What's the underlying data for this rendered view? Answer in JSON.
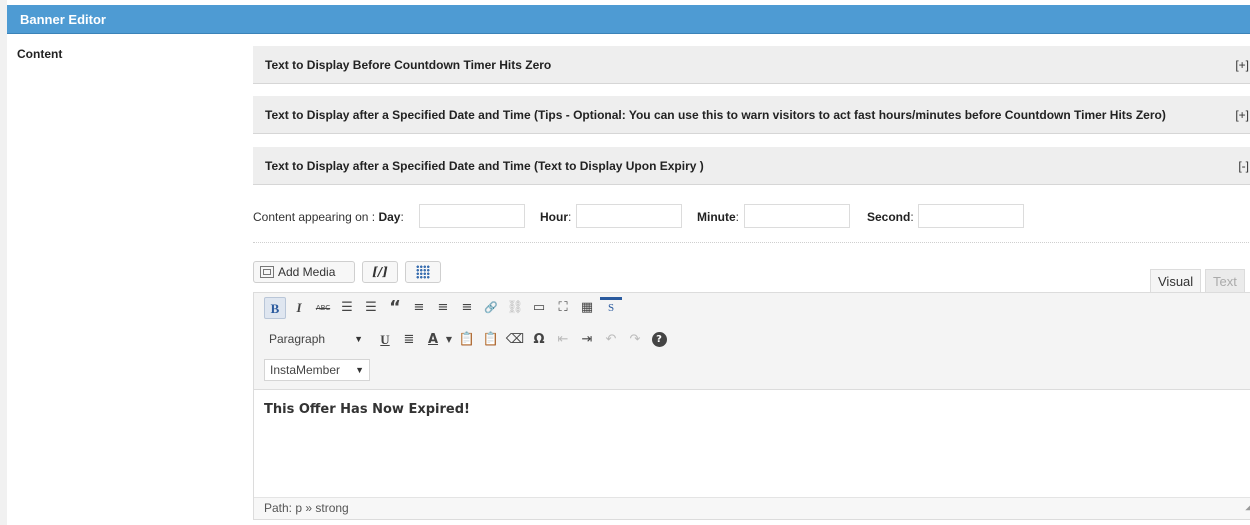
{
  "window": {
    "title": "Banner Editor"
  },
  "content_label": "Content",
  "accordions": [
    {
      "title": "Text to Display Before Countdown Timer Hits Zero",
      "toggle": "[+]"
    },
    {
      "title": "Text to Display after a Specified Date and Time (Tips - Optional: You can use this to warn visitors to act fast hours/minutes before Countdown Timer Hits Zero)",
      "toggle": "[+]"
    },
    {
      "title": "Text to Display after a Specified Date and Time (Text to Display Upon Expiry )",
      "toggle": "[-]"
    }
  ],
  "schedule": {
    "prefix": "Content appearing on : ",
    "day_label": "Day",
    "hour_label": "Hour",
    "minute_label": "Minute",
    "second_label": "Second",
    "day_value": "",
    "hour_value": "",
    "minute_value": "",
    "second_value": ""
  },
  "media": {
    "add_media_label": "Add Media",
    "shortcode_label": "[/]"
  },
  "tabs": {
    "visual": "Visual",
    "text": "Text"
  },
  "toolbar": {
    "row1": [
      "B",
      "I",
      "ABC",
      "☰",
      "☰",
      "“",
      "≡",
      "≡",
      "≡",
      "🔗",
      "⛓",
      "▭",
      "⛶",
      "▦",
      "S"
    ],
    "format_select": "Paragraph",
    "row2": [
      "U",
      "≣",
      "A",
      "📋",
      "📋",
      "⌫",
      "Ω",
      "⇤",
      "⇥",
      "↶",
      "↷",
      "?"
    ],
    "instamember_label": "InstaMember"
  },
  "editor": {
    "content": "This Offer Has Now Expired!"
  },
  "statusbar": {
    "path": "Path: p » strong"
  }
}
